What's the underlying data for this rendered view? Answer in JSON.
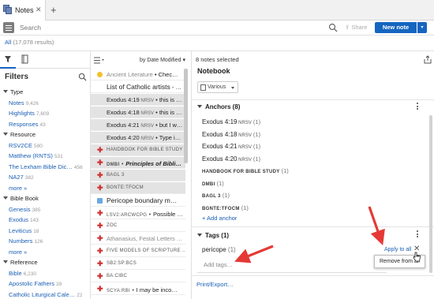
{
  "tab": {
    "label": "Notes",
    "close": "✕",
    "new_tab": "+"
  },
  "search": {
    "placeholder": "Search",
    "share": "Share",
    "new_note": "New note",
    "dropdown": "▾"
  },
  "results": {
    "label": "All",
    "count": "(17,078 results)"
  },
  "filters": {
    "title": "Filters",
    "sections": [
      {
        "label": "Type",
        "items": [
          {
            "label": "Notes",
            "count": "9,426"
          },
          {
            "label": "Highlights",
            "count": "7,609"
          },
          {
            "label": "Responses",
            "count": "43"
          }
        ]
      },
      {
        "label": "Resource",
        "items": [
          {
            "label": "RSV2CE",
            "count": "590"
          },
          {
            "label": "Matthew (RNTS)",
            "count": "531"
          },
          {
            "label": "The Lexham Bible Dic…",
            "count": "456"
          },
          {
            "label": "NA27",
            "count": "382"
          },
          {
            "label": "more »",
            "count": ""
          }
        ]
      },
      {
        "label": "Bible Book",
        "items": [
          {
            "label": "Genesis",
            "count": "385"
          },
          {
            "label": "Exodus",
            "count": "143"
          },
          {
            "label": "Leviticus",
            "count": "18"
          },
          {
            "label": "Numbers",
            "count": "126"
          },
          {
            "label": "more »",
            "count": ""
          }
        ]
      },
      {
        "label": "Reference",
        "items": [
          {
            "label": "Bible",
            "count": "6,230"
          },
          {
            "label": "Apostolic Fathers",
            "count": "39"
          },
          {
            "label": "Catholic Liturgical Cale…",
            "count": "22"
          }
        ]
      }
    ]
  },
  "list": {
    "sort_label": "by Date Modified",
    "rows": [
      {
        "marker": "dot",
        "text": "Ancient Literature",
        "sep": " • ",
        "rest": "Chec…",
        "style": "gray",
        "selected": false
      },
      {
        "marker": "none",
        "text": "List of Catholic artists",
        "sep": " - ",
        "rest": "…",
        "style": "big",
        "selected": false
      },
      {
        "marker": "none",
        "text": "Exodus 4:19",
        "ver": "NRSV",
        "sep": " • ",
        "rest": "this is …",
        "style": "ref",
        "selected": true
      },
      {
        "marker": "none",
        "text": "Exodus 4:18",
        "ver": "NRSV",
        "sep": " • ",
        "rest": "this is …",
        "style": "ref",
        "selected": true
      },
      {
        "marker": "none",
        "text": "Exodus 4:21",
        "ver": "NRSV",
        "sep": " • ",
        "rest": "but I w…",
        "style": "ref",
        "selected": true
      },
      {
        "marker": "none",
        "text": "Exodus 4:20",
        "ver": "NRSV",
        "sep": " • ",
        "rest": "Type i…",
        "style": "ref",
        "selected": true
      },
      {
        "marker": "cross",
        "text": "HANDBOOK FOR BIBLE STUDY",
        "sep": "",
        "rest": "",
        "style": "sc",
        "selected": true
      },
      {
        "marker": "cross",
        "text": "DMBI",
        "sep": " • ",
        "rest": "Principles of Bibli…",
        "style": "scbold",
        "selected": true
      },
      {
        "marker": "cross",
        "text": "BAGL 3",
        "sep": "",
        "rest": "",
        "style": "sc",
        "selected": true
      },
      {
        "marker": "cross",
        "text": "BGNTE:TFOCM",
        "sep": "",
        "rest": "",
        "style": "sc",
        "selected": true
      },
      {
        "marker": "sq",
        "text": "Pericope boundary m…",
        "sep": "",
        "rest": "",
        "style": "big",
        "selected": false
      },
      {
        "marker": "cross",
        "text": "LSV2:ARCWCPG",
        "sep": " • ",
        "rest": "Possible …",
        "style": "scmix",
        "selected": false
      },
      {
        "marker": "cross",
        "text": "ZOC",
        "sep": "",
        "rest": "",
        "style": "sc",
        "selected": false
      },
      {
        "marker": "cross",
        "text": "Athanasius, Festal Letters …",
        "sep": "",
        "rest": "",
        "style": "gray",
        "selected": false
      },
      {
        "marker": "cross",
        "text": "FIVE MODELS OF SCRIPTURE …",
        "sep": "",
        "rest": "",
        "style": "sc",
        "selected": false
      },
      {
        "marker": "cross",
        "text": "SB2:SP:BCS",
        "sep": "",
        "rest": "",
        "style": "sc",
        "selected": false
      },
      {
        "marker": "cross",
        "text": "BA:CIBC",
        "sep": "",
        "rest": "",
        "style": "sc",
        "selected": false
      },
      {
        "marker": "cross",
        "text": "SCYA:RBI",
        "sep": " • ",
        "rest": "I may be inco…",
        "style": "scmix",
        "selected": false
      }
    ]
  },
  "detail": {
    "selected_count": "8 notes selected",
    "notebook_title": "Notebook",
    "notebook_value": "Various",
    "anchors_title": "Anchors (8)",
    "anchors": [
      {
        "text": "Exodus 4:19",
        "ver": "NRSV",
        "count": "(1)",
        "sc": false
      },
      {
        "text": "Exodus 4:18",
        "ver": "NRSV",
        "count": "(1)",
        "sc": false
      },
      {
        "text": "Exodus 4:21",
        "ver": "NRSV",
        "count": "(1)",
        "sc": false
      },
      {
        "text": "Exodus 4:20",
        "ver": "NRSV",
        "count": "(1)",
        "sc": false
      },
      {
        "text": "HANDBOOK FOR BIBLE STUDY",
        "ver": "",
        "count": "(1)",
        "sc": true
      },
      {
        "text": "DMBI",
        "ver": "",
        "count": "(1)",
        "sc": true
      },
      {
        "text": "BAGL 3",
        "ver": "",
        "count": "(1)",
        "sc": true
      },
      {
        "text": "BGNTE:TFOCM",
        "ver": "",
        "count": "(1)",
        "sc": true
      }
    ],
    "add_anchor": "+ Add anchor",
    "tags_title": "Tags (1)",
    "tag": "pericope",
    "tag_count": "(1)",
    "add_tags_placeholder": "Add tags…",
    "apply_all": "Apply to all",
    "remove_tooltip": "Remove from all",
    "print_export": "Print/Export…"
  },
  "colors": {
    "accent": "#1565c0",
    "annotation_arrow": "#e53935",
    "highlight_yellow": "#f0c22b",
    "marker_red": "#d12f2f"
  }
}
